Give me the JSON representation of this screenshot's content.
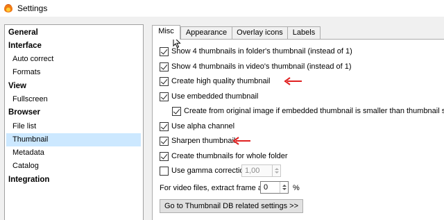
{
  "window": {
    "title": "Settings",
    "icon": "app-flame-icon"
  },
  "tree": {
    "items": [
      {
        "label": "General",
        "kind": "category"
      },
      {
        "label": "Interface",
        "kind": "category"
      },
      {
        "label": "Auto correct",
        "kind": "sub"
      },
      {
        "label": "Formats",
        "kind": "sub"
      },
      {
        "label": "View",
        "kind": "category"
      },
      {
        "label": "Fullscreen",
        "kind": "sub"
      },
      {
        "label": "Browser",
        "kind": "category"
      },
      {
        "label": "File list",
        "kind": "sub"
      },
      {
        "label": "Thumbnail",
        "kind": "sub",
        "selected": true
      },
      {
        "label": "Metadata",
        "kind": "sub"
      },
      {
        "label": "Catalog",
        "kind": "sub"
      },
      {
        "label": "Integration",
        "kind": "category"
      }
    ]
  },
  "tabs": [
    {
      "label": "Misc",
      "active": true
    },
    {
      "label": "Appearance"
    },
    {
      "label": "Overlay icons"
    },
    {
      "label": "Labels"
    }
  ],
  "misc": {
    "options": [
      {
        "label": "Show 4 thumbnails in folder's thumbnail (instead of 1)",
        "checked": true
      },
      {
        "label": "Show 4 thumbnails in video's thumbnail (instead of 1)",
        "checked": true
      },
      {
        "label": "Create high quality thumbnail",
        "checked": true,
        "highlighted": true
      },
      {
        "label": "Use embedded thumbnail",
        "checked": true
      },
      {
        "label": "Create from original image if embedded thumbnail is smaller than thumbnail size",
        "checked": true
      },
      {
        "label": "Use alpha channel",
        "checked": true
      },
      {
        "label": "Sharpen thumbnail",
        "checked": true,
        "highlighted": true
      },
      {
        "label": "Create  thumbnails for whole folder",
        "checked": true
      },
      {
        "label": "Use gamma correction",
        "checked": false
      }
    ],
    "gamma_value": "1,00",
    "video_frame_label": "For video files, extract frame at",
    "video_frame_value": "0",
    "video_frame_unit": "%",
    "db_button_label": "Go to Thumbnail DB related settings >>"
  },
  "colors": {
    "annotation_arrow": "#e02020",
    "selection": "#cce8ff"
  }
}
